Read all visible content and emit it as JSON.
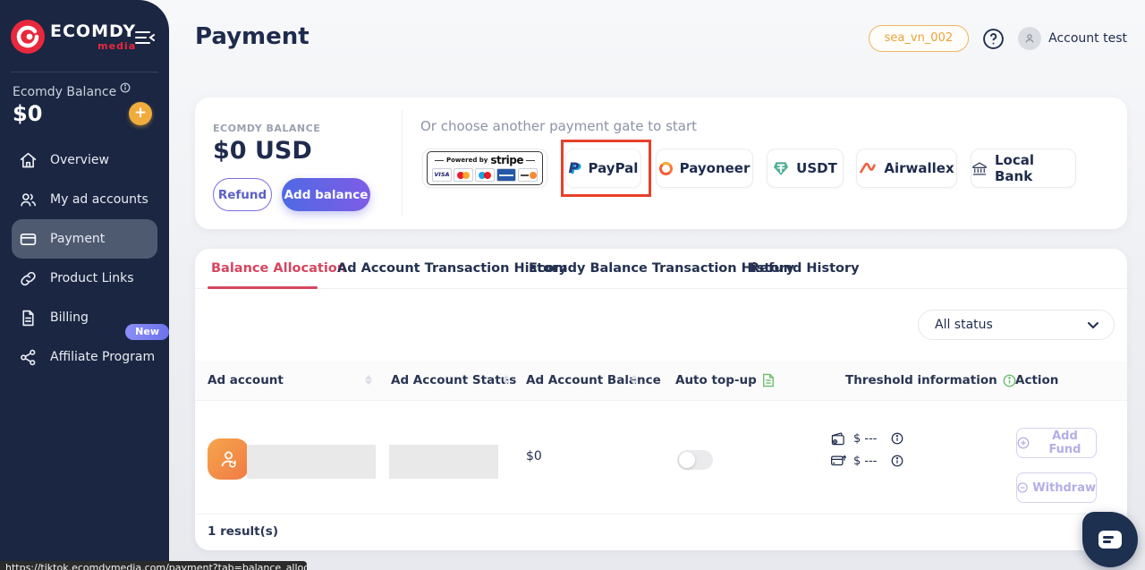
{
  "page": {
    "status_url": "https://tiktok.ecomdymedia.com/payment?tab=balance_allocation#"
  },
  "sidebar": {
    "brand": "ECOMDY",
    "brand_sub": "media",
    "balance_label": "Ecomdy Balance",
    "balance_value": "$0",
    "add_button": "+",
    "items": [
      {
        "label": "Overview",
        "icon": "home-icon"
      },
      {
        "label": "My ad accounts",
        "icon": "users-icon"
      },
      {
        "label": "Payment",
        "icon": "credit-card-icon",
        "active": true
      },
      {
        "label": "Product Links",
        "icon": "link-icon"
      },
      {
        "label": "Billing",
        "icon": "billing-doc-icon"
      },
      {
        "label": "Affiliate Program",
        "icon": "share-icon",
        "badge": "New"
      }
    ]
  },
  "header": {
    "title": "Payment",
    "org_tag": "sea_vn_002",
    "account_name": "Account test"
  },
  "balance_card": {
    "label": "ECOMDY BALANCE",
    "value": "$0 USD",
    "refund_label": "Refund",
    "add_balance_label": "Add balance",
    "gate_prompt": "Or choose another payment gate to start",
    "stripe_badge": {
      "powered_by": "Powered by",
      "brand": "stripe",
      "visa_text": "VISA"
    },
    "gates": [
      {
        "label": "PayPal",
        "icon": "paypal-icon",
        "highlighted": true
      },
      {
        "label": "Payoneer",
        "icon": "payoneer-icon"
      },
      {
        "label": "USDT",
        "icon": "usdt-icon"
      },
      {
        "label": "Airwallex",
        "icon": "airwallex-icon"
      },
      {
        "label": "Local Bank",
        "icon": "bank-icon"
      }
    ]
  },
  "tabs": [
    {
      "label": "Balance Allocation",
      "active": true
    },
    {
      "label": "Ad Account Transaction History"
    },
    {
      "label": "Ecomdy Balance Transaction History"
    },
    {
      "label": "Refund History"
    }
  ],
  "filters": {
    "status_selected": "All status"
  },
  "table": {
    "columns": [
      {
        "label": "Ad account",
        "sortable": true
      },
      {
        "label": "Ad Account Status",
        "sortable": true
      },
      {
        "label": "Ad Account Balance",
        "sortable": true
      },
      {
        "label": "Auto top-up",
        "icon": "green-doc-icon"
      },
      {
        "label": "Threshold information",
        "icon": "green-info-icon"
      },
      {
        "label": "Action"
      }
    ],
    "row": {
      "balance": "$0",
      "auto_top_up_enabled": false,
      "threshold": [
        {
          "icon": "wallet-icon",
          "value": "$ ---"
        },
        {
          "icon": "card-topup-icon",
          "value": "$ ---"
        }
      ],
      "actions": [
        {
          "label": "Add Fund",
          "icon": "plus-circle-icon"
        },
        {
          "label": "Withdraw",
          "icon": "minus-circle-icon"
        }
      ]
    },
    "footer": "1 result(s)"
  },
  "colors": {
    "sidebar_bg": "#1a2642",
    "accent_red": "#d6465f",
    "accent_orange": "#f0ac3c",
    "button_gradient_start": "#4f6ae4",
    "button_gradient_end": "#7e5ce6",
    "highlight_border": "#e8402a",
    "green": "#6abf69"
  }
}
